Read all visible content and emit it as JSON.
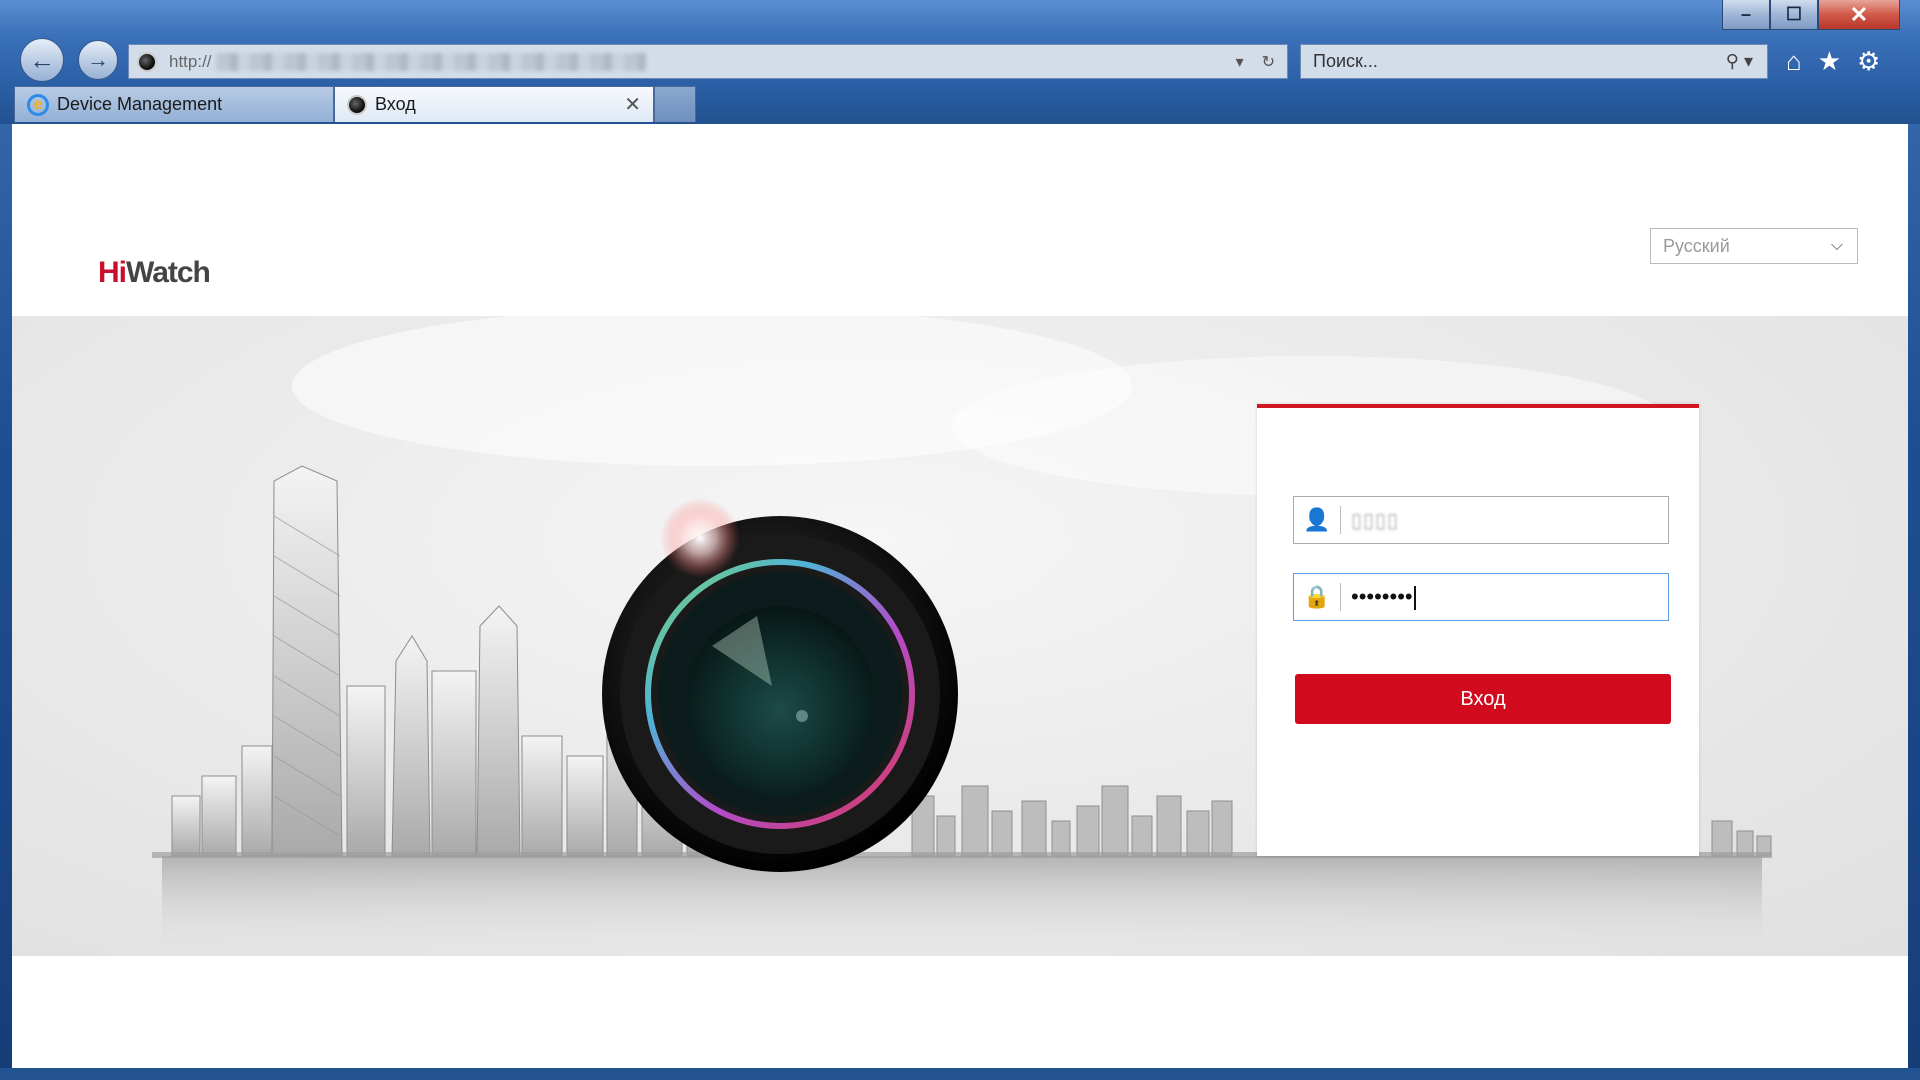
{
  "browser": {
    "address": {
      "prefix": "http://"
    },
    "search": {
      "placeholder": "Поиск..."
    },
    "tabs": [
      {
        "label": "Device Management",
        "active": false
      },
      {
        "label": "Вход",
        "active": true
      }
    ],
    "icons": {
      "back": "back-arrow-icon",
      "forward": "forward-arrow-icon",
      "home": "home-icon",
      "favorites": "star-icon",
      "settings": "gear-icon"
    }
  },
  "page": {
    "logo": {
      "hi": "Hi",
      "watch": "Watch"
    },
    "language": {
      "selected": "Русский"
    },
    "login": {
      "password_mask": "••••••••",
      "submit_label": "Вход"
    },
    "colors": {
      "accent": "#d10a1d",
      "logo_red": "#c8102e"
    }
  }
}
